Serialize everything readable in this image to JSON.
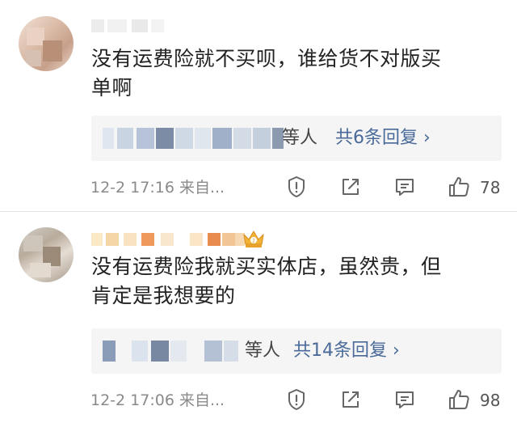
{
  "comments": [
    {
      "text_line1": "没有运费险就不买呗，谁给货不对版买",
      "text_line2": "单啊",
      "reply_suffix": "等人",
      "reply_count_label": "共6条回复 ›",
      "timestamp": "12-2 17:16 来自...",
      "likes": "78"
    },
    {
      "text_line1": "没有运费险我就买实体店，虽然贵，但",
      "text_line2": "肯定是我想要的",
      "reply_suffix": "等人",
      "reply_count_label": "共14条回复 ›",
      "timestamp": "12-2 17:06 来自...",
      "likes": "98"
    }
  ],
  "icons": {
    "report": "report-icon",
    "share": "share-icon",
    "comment": "comment-icon",
    "like": "thumbs-up-icon",
    "badge": "crown-badge-icon"
  },
  "colors": {
    "text": "#222222",
    "link": "#4a6a9a",
    "meta": "#8a8a8a",
    "reply_bg": "#f5f5f5",
    "badge_gold": "#f2b233"
  }
}
